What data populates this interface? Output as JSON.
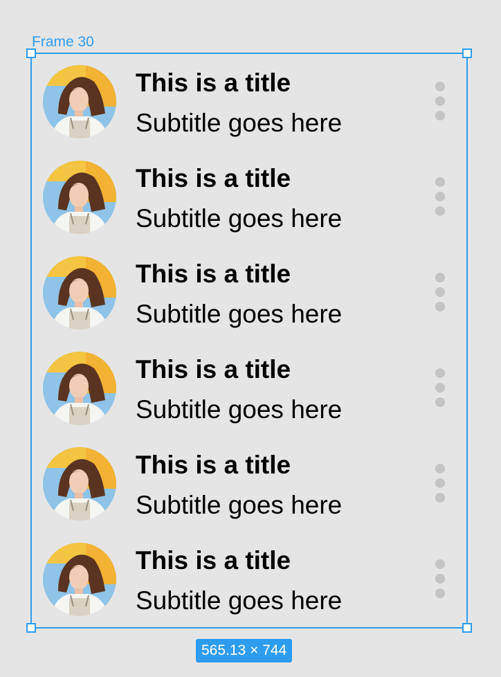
{
  "frame": {
    "label": "Frame 30",
    "dimensions": "565.13 × 744",
    "accent_color": "#2d9cf0"
  },
  "list": {
    "items": [
      {
        "title": "This is a title",
        "subtitle": "Subtitle goes here",
        "avatar": "avatar-photo",
        "menu_icon": "more-vertical-icon"
      },
      {
        "title": "This is a title",
        "subtitle": "Subtitle goes here",
        "avatar": "avatar-photo",
        "menu_icon": "more-vertical-icon"
      },
      {
        "title": "This is a title",
        "subtitle": "Subtitle goes here",
        "avatar": "avatar-photo",
        "menu_icon": "more-vertical-icon"
      },
      {
        "title": "This is a title",
        "subtitle": "Subtitle goes here",
        "avatar": "avatar-photo",
        "menu_icon": "more-vertical-icon"
      },
      {
        "title": "This is a title",
        "subtitle": "Subtitle goes here",
        "avatar": "avatar-photo",
        "menu_icon": "more-vertical-icon"
      },
      {
        "title": "This is a title",
        "subtitle": "Subtitle goes here",
        "avatar": "avatar-photo",
        "menu_icon": "more-vertical-icon"
      }
    ]
  }
}
